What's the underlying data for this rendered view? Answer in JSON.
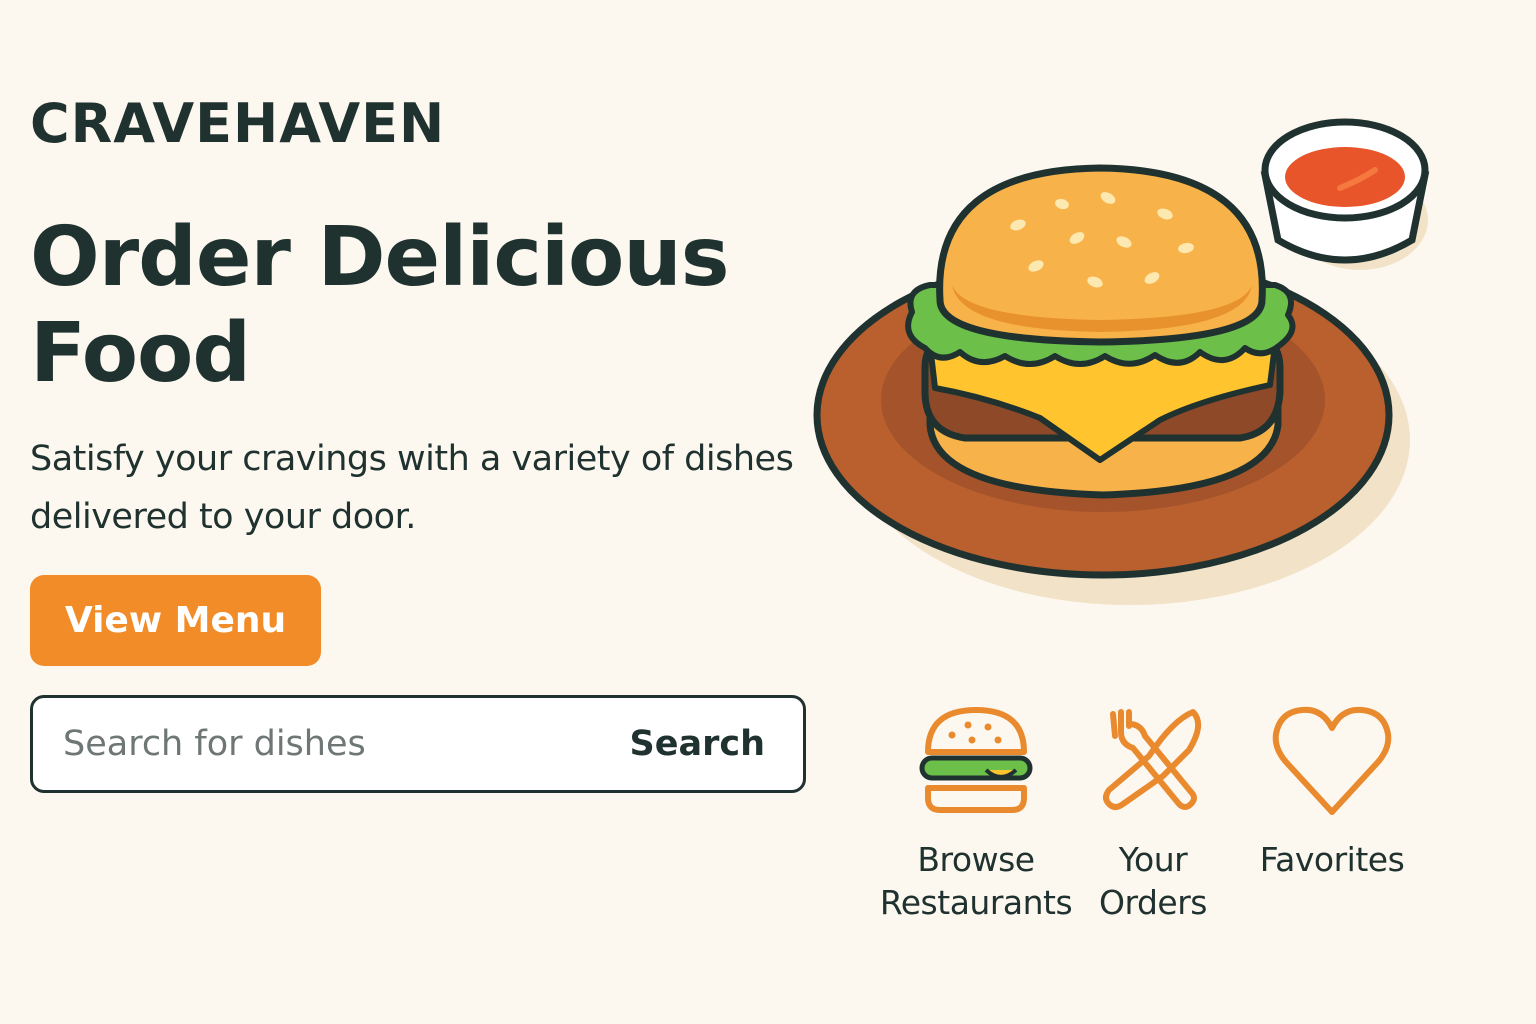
{
  "brand": {
    "name": "CRAVEHAVEN"
  },
  "hero": {
    "title": "Order Delicious Food",
    "subtitle": "Satisfy your cravings with a variety of dishes delivered to your door.",
    "cta_label": "View Menu",
    "illustration": "burger-on-plate-with-sauce-cup"
  },
  "search": {
    "placeholder": "Search for dishes",
    "value": "",
    "button_label": "Search"
  },
  "quick_links": [
    {
      "label": "Browse\nRestaurants",
      "icon": "burger-icon"
    },
    {
      "label": "Your\nOrders",
      "icon": "fork-knife-icon"
    },
    {
      "label": "Favorites",
      "icon": "heart-icon"
    }
  ],
  "colors": {
    "background": "#fdf8ef",
    "text": "#1f3230",
    "accent": "#f28c28"
  }
}
